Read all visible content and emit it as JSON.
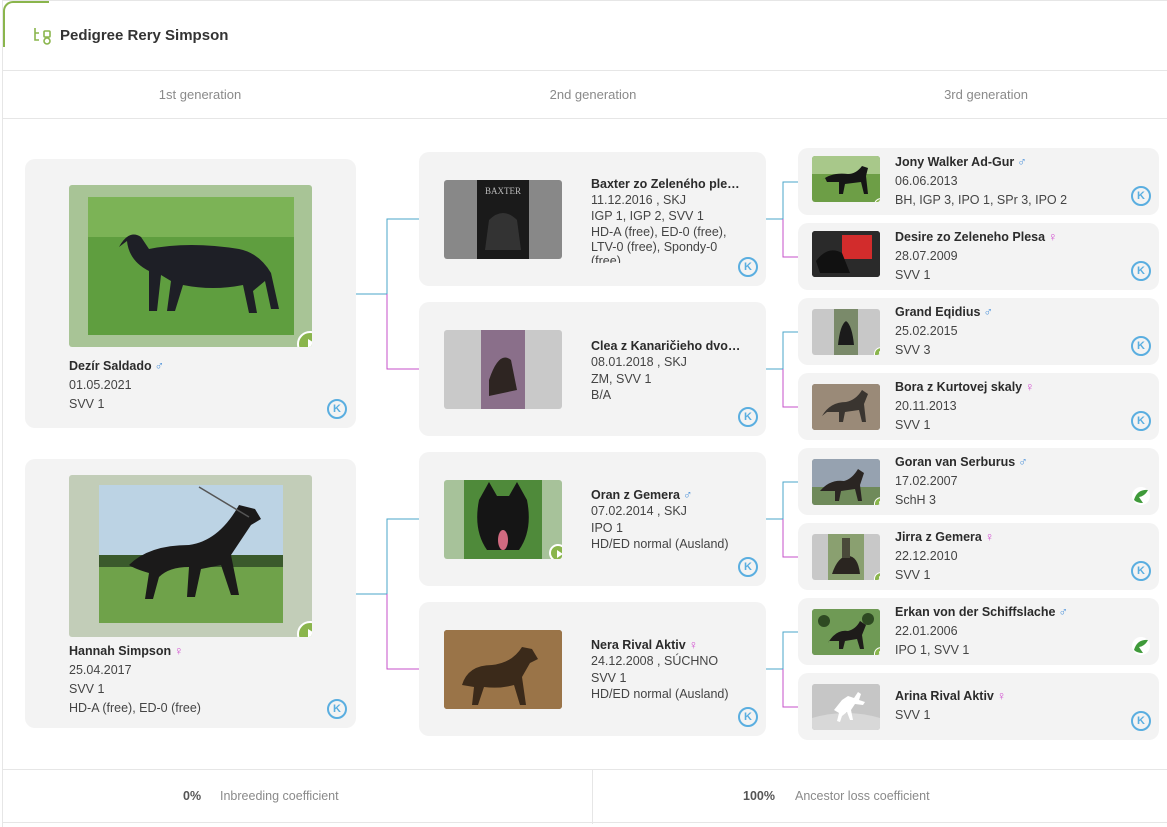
{
  "header": {
    "title": "Pedigree Rery Simpson",
    "icon": "pedigree-tree-icon"
  },
  "generations": [
    "1st generation",
    "2nd generation",
    "3rd generation"
  ],
  "colors": {
    "accent": "#8ab54c",
    "male": "#4a90d9",
    "female": "#d24fd0",
    "connector_male": "#4aa6c9",
    "connector_female": "#c64fc8"
  },
  "gen1": [
    {
      "name": "Dezír Saldado",
      "sex": "♂",
      "date": "01.05.2021",
      "lines": [
        "SVV 1"
      ],
      "logo": "k-club-logo"
    },
    {
      "name": "Hannah Simpson",
      "sex": "♀",
      "date": "25.04.2017",
      "lines": [
        "SVV 1",
        "HD-A (free), ED-0 (free)"
      ],
      "logo": "k-club-logo"
    }
  ],
  "gen2": [
    {
      "name": "Baxter zo Zeleného ples…",
      "sex": "",
      "date": "11.12.2016 , SKJ",
      "lines": [
        "IGP 1, IGP 2, SVV 1",
        "HD-A (free), ED-0 (free),",
        "LTV-0 (free), Spondy-0",
        "(free)"
      ],
      "logo": "k-club-logo"
    },
    {
      "name": "Clea z Kanaričieho dvor…",
      "sex": "",
      "date": "08.01.2018 , SKJ",
      "lines": [
        "ZM, SVV 1",
        "B/A"
      ],
      "logo": "k-club-logo"
    },
    {
      "name": "Oran z Gemera",
      "sex": "♂",
      "date": "07.02.2014 , SKJ",
      "lines": [
        "IPO 1",
        "HD/ED normal (Ausland)"
      ],
      "logo": "k-club-logo"
    },
    {
      "name": "Nera Rival Aktiv",
      "sex": "♀",
      "date": "24.12.2008 , SÚCHNO",
      "lines": [
        "SVV 1",
        "HD/ED normal (Ausland)"
      ],
      "logo": "k-club-logo"
    }
  ],
  "gen3": [
    {
      "name": "Jony Walker Ad-Gur",
      "sex": "♂",
      "date": "06.06.2013",
      "lines": [
        "BH, IGP 3, IPO 1, SPr 3, IPO 2"
      ],
      "logo": "k-club-logo"
    },
    {
      "name": "Desire zo Zeleneho Plesa",
      "sex": "♀",
      "date": "28.07.2009",
      "lines": [
        "SVV 1"
      ],
      "logo": "k-club-logo"
    },
    {
      "name": "Grand Eqidius",
      "sex": "♂",
      "date": "25.02.2015",
      "lines": [
        "SVV 3"
      ],
      "logo": "k-club-logo"
    },
    {
      "name": "Bora z Kurtovej skaly",
      "sex": "♀",
      "date": "20.11.2013",
      "lines": [
        "SVV 1"
      ],
      "logo": "k-club-logo"
    },
    {
      "name": "Goran van Serburus",
      "sex": "♂",
      "date": "17.02.2007",
      "lines": [
        "SchH 3"
      ],
      "logo": "green-leaf-logo"
    },
    {
      "name": "Jirra z Gemera",
      "sex": "♀",
      "date": "22.12.2010",
      "lines": [
        "SVV 1"
      ],
      "logo": "k-club-logo"
    },
    {
      "name": "Erkan von der Schiffslache",
      "sex": "♂",
      "date": "22.01.2006",
      "lines": [
        "IPO 1, SVV 1"
      ],
      "logo": "green-leaf-logo"
    },
    {
      "name": "Arina Rival Aktiv",
      "sex": "♀",
      "date": "",
      "lines": [
        "SVV 1"
      ],
      "logo": "k-club-logo"
    }
  ],
  "stats": {
    "inbreeding_value": "0%",
    "inbreeding_label": "Inbreeding coefficient",
    "ancestor_value": "100%",
    "ancestor_label": "Ancestor loss coefficient"
  }
}
